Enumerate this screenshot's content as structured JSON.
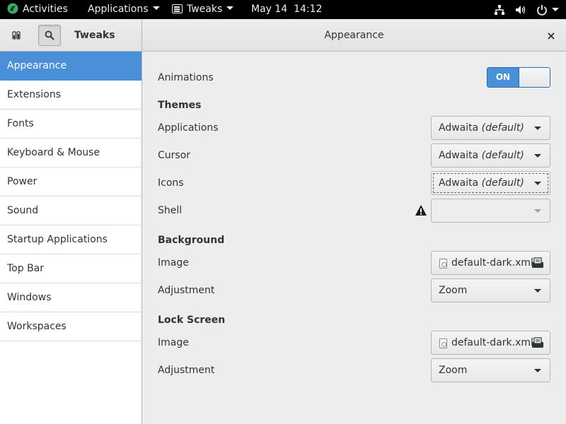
{
  "topbar": {
    "activities": "Activities",
    "applications": "Applications",
    "app_name": "Tweaks",
    "clock": "May 14  14:12"
  },
  "headerbar": {
    "app_title": "Tweaks",
    "page_title": "Appearance",
    "close_symbol": "×"
  },
  "sidebar": {
    "items": [
      {
        "label": "Appearance"
      },
      {
        "label": "Extensions"
      },
      {
        "label": "Fonts"
      },
      {
        "label": "Keyboard & Mouse"
      },
      {
        "label": "Power"
      },
      {
        "label": "Sound"
      },
      {
        "label": "Startup Applications"
      },
      {
        "label": "Top Bar"
      },
      {
        "label": "Windows"
      },
      {
        "label": "Workspaces"
      }
    ],
    "selected_index": 0
  },
  "content": {
    "animations": {
      "label": "Animations",
      "switch_label": "ON",
      "state": true
    },
    "themes": {
      "heading": "Themes",
      "applications": {
        "label": "Applications",
        "value": "Adwaita",
        "suffix": "(default)"
      },
      "cursor": {
        "label": "Cursor",
        "value": "Adwaita",
        "suffix": "(default)"
      },
      "icons": {
        "label": "Icons",
        "value": "Adwaita",
        "suffix": "(default)"
      },
      "shell": {
        "label": "Shell",
        "value": ""
      }
    },
    "background": {
      "heading": "Background",
      "image": {
        "label": "Image",
        "value": "default-dark.xml"
      },
      "adjustment": {
        "label": "Adjustment",
        "value": "Zoom"
      }
    },
    "lock_screen": {
      "heading": "Lock Screen",
      "image": {
        "label": "Image",
        "value": "default-dark.xml"
      },
      "adjustment": {
        "label": "Adjustment",
        "value": "Zoom"
      }
    }
  },
  "colors": {
    "accent": "#4a90d9",
    "topbar_bg": "#000000",
    "window_bg": "#ededed"
  },
  "icons": [
    "gnome-logo-icon",
    "caret-down-icon",
    "app-icon",
    "network-icon",
    "volume-icon",
    "power-icon",
    "sidebar-toggle-icon",
    "search-icon",
    "close-icon",
    "warning-icon",
    "file-icon",
    "open-folder-icon"
  ]
}
